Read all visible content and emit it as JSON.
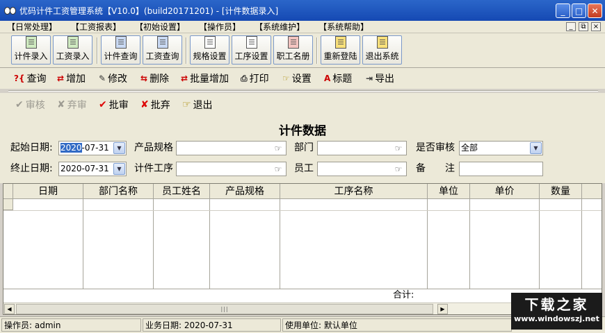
{
  "window": {
    "title": "优码计件工资管理系统【V10.0】(build20171201) - [计件数据录入]",
    "buttons": [
      "_",
      "□",
      "✕"
    ]
  },
  "menu": {
    "items": [
      "【日常处理】",
      "【工资报表】",
      "【初始设置】",
      "【操作员】",
      "【系统维护】",
      "【系统帮助】"
    ],
    "mdi_buttons": [
      "_",
      "⧉",
      "×"
    ]
  },
  "big_toolbar": {
    "buttons": [
      {
        "label": "计件录入",
        "icon": "piece-entry-icon"
      },
      {
        "label": "工资录入",
        "icon": "wage-entry-icon"
      },
      {
        "label": "计件查询",
        "icon": "piece-query-icon"
      },
      {
        "label": "工资查询",
        "icon": "wage-query-icon"
      },
      {
        "label": "规格设置",
        "icon": "spec-settings-icon"
      },
      {
        "label": "工序设置",
        "icon": "process-settings-icon"
      },
      {
        "label": "职工名册",
        "icon": "staff-roster-icon"
      },
      {
        "label": "重新登陆",
        "icon": "relogin-icon"
      },
      {
        "label": "退出系统",
        "icon": "exit-system-icon"
      }
    ]
  },
  "function_toolbar": {
    "query": "查询",
    "add": "增加",
    "edit": "修改",
    "delete": "删除",
    "batch_add": "批量增加",
    "print": "打印",
    "settings": "设置",
    "title": "标题",
    "export": "导出"
  },
  "audit_toolbar": {
    "approve": "审核",
    "abandon": "弃审",
    "batch_approve": "批审",
    "batch_abandon": "批弃",
    "exit": "退出"
  },
  "form": {
    "title": "计件数据",
    "start_date_label": "起始日期:",
    "start_date_selected": "2020",
    "start_date_rest": "-07-31",
    "end_date_label": "终止日期:",
    "end_date_value": "2020-07-31",
    "product_spec_label": "产品规格",
    "piece_process_label": "计件工序",
    "department_label": "部门",
    "employee_label": "员工",
    "audited_label": "是否审核",
    "audited_value": "全部",
    "remark_label": "备　　注"
  },
  "table": {
    "columns": [
      "日期",
      "部门名称",
      "员工姓名",
      "产品规格",
      "工序名称",
      "单位",
      "单价",
      "数量"
    ],
    "total_label": "合计:"
  },
  "status_bar": {
    "operator": "操作员: admin",
    "business_date": "业务日期: 2020-07-31",
    "unit": "使用单位: 默认单位"
  },
  "watermark": {
    "main": "下载之家",
    "url": "www.windowszj.net"
  }
}
